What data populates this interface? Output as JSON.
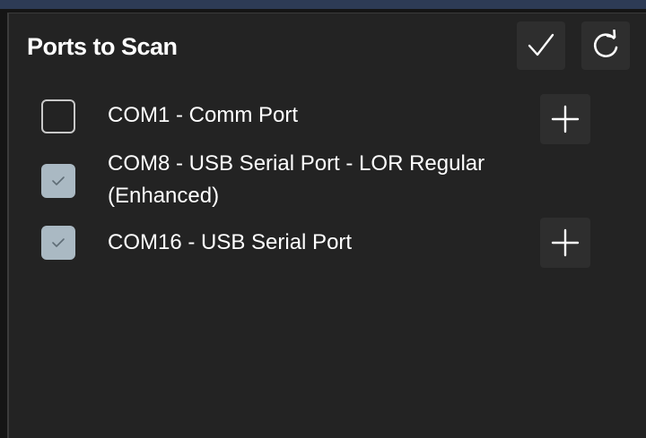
{
  "panel": {
    "title": "Ports to Scan",
    "confirm_icon": "checkmark-icon",
    "refresh_icon": "refresh-icon"
  },
  "ports": [
    {
      "label": "COM1 - Comm Port",
      "checked": false,
      "has_add": true
    },
    {
      "label": "COM8 - USB Serial Port - LOR Regular (Enhanced)",
      "checked": true,
      "has_add": false
    },
    {
      "label": "COM16 - USB Serial Port",
      "checked": true,
      "has_add": true
    }
  ],
  "colors": {
    "background": "#232323",
    "checkbox_checked": "#aab9c3",
    "button_bg": "#2e2e2e",
    "text": "#ffffff"
  }
}
